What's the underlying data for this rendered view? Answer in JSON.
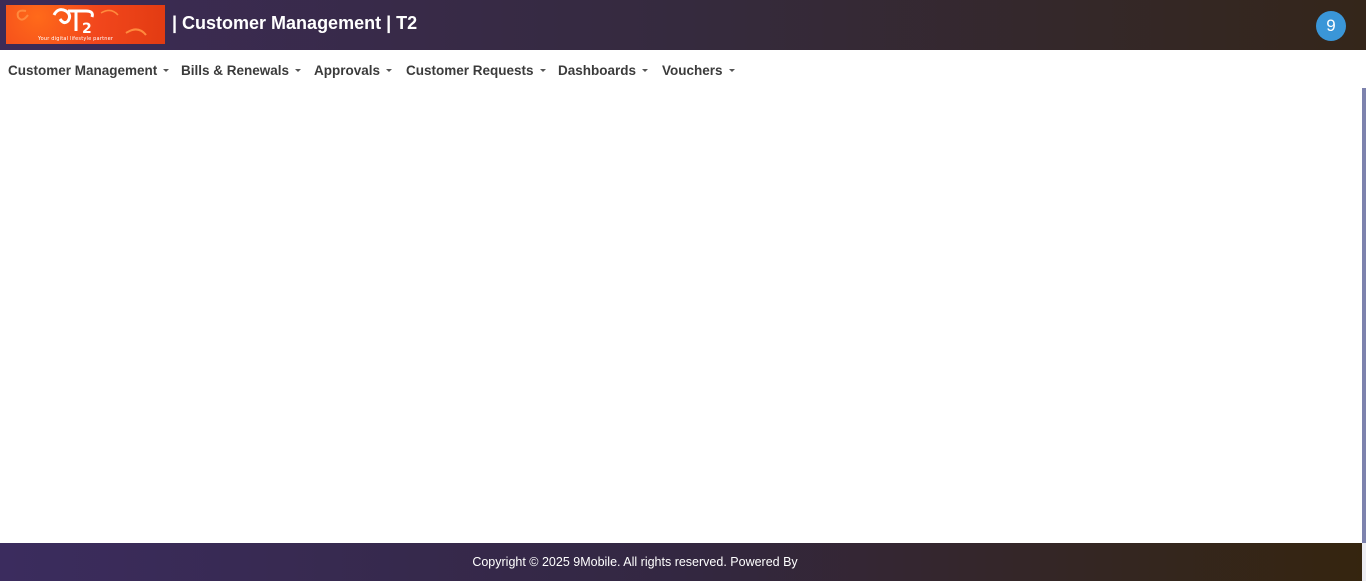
{
  "header": {
    "title": "| Customer Management | T2",
    "logo_text": "T2",
    "logo_tagline": "Your digital lifestyle partner",
    "notification_count": "9"
  },
  "nav": {
    "items": [
      {
        "label": "Customer Management"
      },
      {
        "label": "Bills & Renewals"
      },
      {
        "label": "Approvals"
      },
      {
        "label": "Customer Requests"
      },
      {
        "label": "Dashboards"
      },
      {
        "label": "Vouchers"
      }
    ]
  },
  "footer": {
    "text": "Copyright © 2025 9Mobile. All rights reserved. Powered By"
  },
  "colors": {
    "header_gradient_start": "#3c2b57",
    "header_gradient_end": "#34261a",
    "badge": "#3a96d8",
    "logo_orange": "#f2471c"
  }
}
